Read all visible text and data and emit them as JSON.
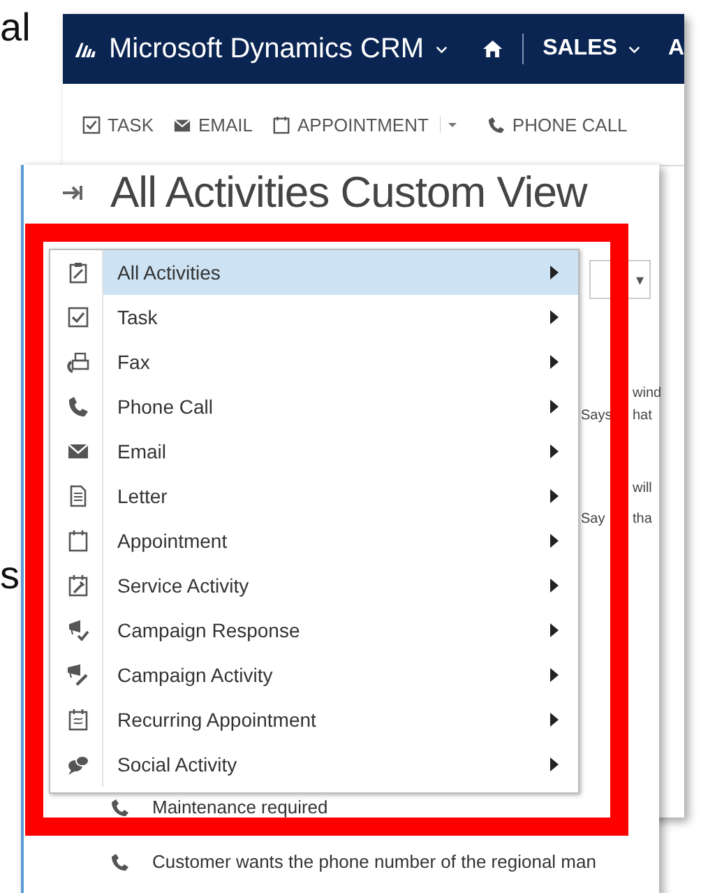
{
  "left_fragments": [
    {
      "text": "al"
    },
    {
      "text": "s"
    }
  ],
  "header": {
    "app_name": "Microsoft Dynamics CRM",
    "area": "SALES",
    "next_area": "A"
  },
  "toolbar": [
    {
      "label": "TASK",
      "kind": "task"
    },
    {
      "label": "EMAIL",
      "kind": "email"
    },
    {
      "label": "APPOINTMENT",
      "kind": "appointment"
    },
    {
      "label": "PHONE CALL",
      "kind": "phone"
    }
  ],
  "page": {
    "title": "All Activities Custom View",
    "view_selector": "▾",
    "fragments": [
      {
        "text": "wind"
      },
      {
        "text": "Says"
      },
      {
        "text": "hat"
      },
      {
        "text": "will"
      },
      {
        "text": "Say"
      },
      {
        "text": "tha"
      }
    ],
    "rows": [
      {
        "text": "Maintenance required",
        "kind": "phone"
      },
      {
        "text": "Customer wants the phone number of the regional man",
        "kind": "phone"
      }
    ]
  },
  "menu": [
    {
      "label": "All Activities",
      "kind": "all",
      "selected": true
    },
    {
      "label": "Task",
      "kind": "task",
      "selected": false
    },
    {
      "label": "Fax",
      "kind": "fax",
      "selected": false
    },
    {
      "label": "Phone Call",
      "kind": "phone",
      "selected": false
    },
    {
      "label": "Email",
      "kind": "email",
      "selected": false
    },
    {
      "label": "Letter",
      "kind": "letter",
      "selected": false
    },
    {
      "label": "Appointment",
      "kind": "appointment",
      "selected": false
    },
    {
      "label": "Service Activity",
      "kind": "service",
      "selected": false
    },
    {
      "label": "Campaign Response",
      "kind": "campaign_response",
      "selected": false
    },
    {
      "label": "Campaign Activity",
      "kind": "campaign_activity",
      "selected": false
    },
    {
      "label": "Recurring Appointment",
      "kind": "recurring",
      "selected": false
    },
    {
      "label": "Social Activity",
      "kind": "social",
      "selected": false
    }
  ]
}
